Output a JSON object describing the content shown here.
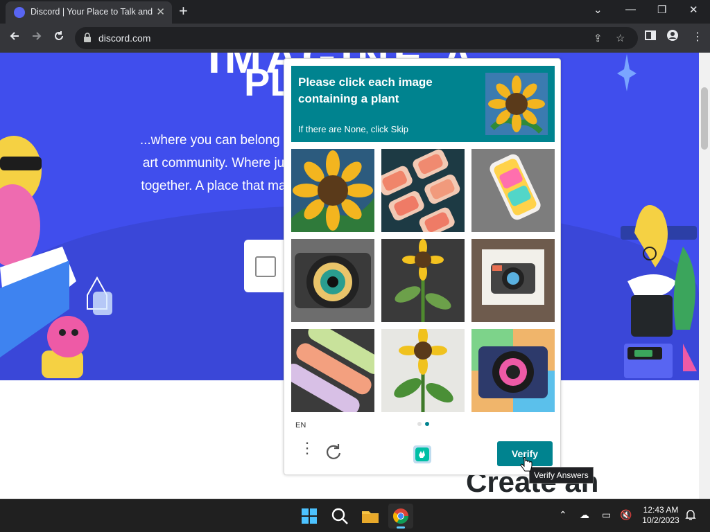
{
  "browser": {
    "tab_title": "Discord | Your Place to Talk and Hang Out",
    "url": "discord.com",
    "new_tab": "+",
    "tab_close": "✕",
    "win_minimize": "—",
    "win_restore": "❐",
    "win_close": "✕",
    "tab_menu": "⌄"
  },
  "hero": {
    "heading_line1": "IMAGINE A",
    "heading_line2": "PL",
    "text_lines": [
      "...where you can belong t",
      "art community. Where ju",
      "together. A place that ma"
    ]
  },
  "page": {
    "create_heading": "Create an"
  },
  "captcha": {
    "prompt_title": "Please click each image containing a plant",
    "prompt_sub": "If there are None, click Skip",
    "sample_icon": "sunflower",
    "images": [
      {
        "name": "sunflower-painting",
        "bg": "#2c5b7e"
      },
      {
        "name": "sushi-rolls",
        "bg": "#1d3a44"
      },
      {
        "name": "colorful-phone",
        "bg": "#8c8c8c"
      },
      {
        "name": "camera-lens",
        "bg": "#6d6d6d"
      },
      {
        "name": "sunflower-plant",
        "bg": "#3a3a3a"
      },
      {
        "name": "camera-on-paper",
        "bg": "#6e5b4d"
      },
      {
        "name": "sushi-platter",
        "bg": "#3b3b3b"
      },
      {
        "name": "sunflower-sketch",
        "bg": "#e7e7e3"
      },
      {
        "name": "colorful-camera",
        "bg": "#f0b56b"
      }
    ],
    "language": "EN",
    "verify_label": "Verify",
    "tooltip": "Verify Answers",
    "page_dots": [
      {
        "color": "#e0e0e0"
      },
      {
        "color": "#00838f"
      }
    ]
  },
  "taskbar": {
    "time": "12:43 AM",
    "date": "10/2/2023"
  },
  "colors": {
    "discord_blurple": "#404eed",
    "captcha_teal": "#00838f",
    "chrome_dark": "#202124",
    "chrome_toolbar": "#35363a"
  }
}
